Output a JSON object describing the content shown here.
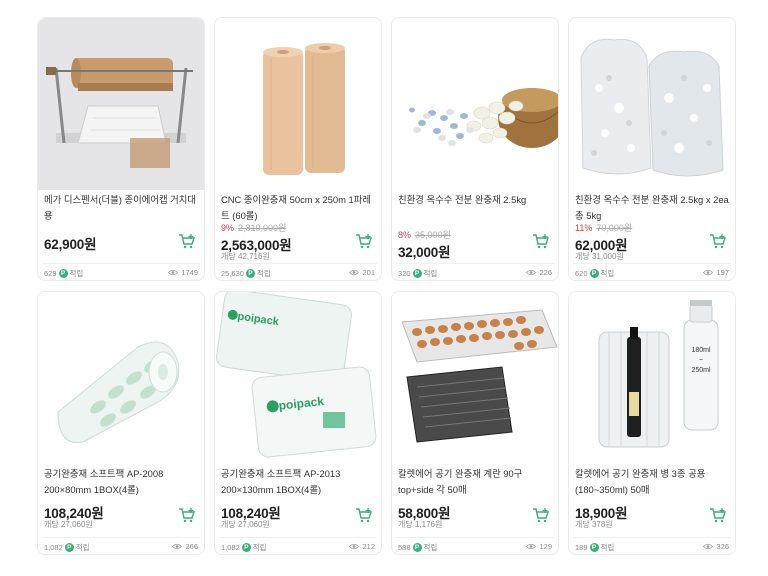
{
  "products": [
    {
      "title": "메가 디스펜서(더블) 종이에어캡 거치대용",
      "discount_rate": "",
      "original_price": "",
      "price": "62,900원",
      "unit_price": "",
      "points": "629",
      "points_label": "적립",
      "views": "1749",
      "image_icon": "paper-dispenser-image"
    },
    {
      "title": "CNC 종이완충재 50cm x 250m 1파레트 (60롤)",
      "discount_rate": "9%",
      "original_price": "2,810,000원",
      "price": "2,563,000원",
      "unit_price": "개당 42,716원",
      "points": "25,630",
      "points_label": "적립",
      "views": "201",
      "image_icon": "kraft-paper-rolls-image"
    },
    {
      "title": "친환경 옥수수 전분 완충재 2.5kg",
      "discount_rate": "8%",
      "original_price": "35,000원",
      "price": "32,000원",
      "unit_price": "",
      "points": "320",
      "points_label": "적립",
      "views": "226",
      "image_icon": "corn-starch-peanuts-image"
    },
    {
      "title": "친환경 옥수수 전분 완충재 2.5kg x 2ea 총 5kg",
      "discount_rate": "11%",
      "original_price": "70,000원",
      "price": "62,000원",
      "unit_price": "개당 31,000원",
      "points": "620",
      "points_label": "적립",
      "views": "197",
      "image_icon": "filler-bags-image"
    },
    {
      "title": "공기완충재 소프트팩 AP-2008 200×80mm 1BOX(4롤)",
      "discount_rate": "",
      "original_price": "",
      "price": "108,240원",
      "unit_price": "개당 27,060원",
      "points": "1,082",
      "points_label": "적립",
      "views": "266",
      "image_icon": "air-cushion-roll-image"
    },
    {
      "title": "공기완충재 소프트팩 AP-2013 200×130mm 1BOX(4롤)",
      "discount_rate": "",
      "original_price": "",
      "price": "108,240원",
      "unit_price": "개당 27,060원",
      "points": "1,082",
      "points_label": "적립",
      "views": "212",
      "image_icon": "poipack-air-bags-image"
    },
    {
      "title": "칼렛에어 공기 완충재 계란 90구 top+side 각 50매",
      "discount_rate": "",
      "original_price": "",
      "price": "58,800원",
      "unit_price": "개당 1,176원",
      "points": "588",
      "points_label": "적립",
      "views": "129",
      "image_icon": "egg-tray-image"
    },
    {
      "title": "칼렛에어 공기 완충재 병 3종 공용 (180~350ml) 50매",
      "discount_rate": "",
      "original_price": "",
      "price": "18,900원",
      "unit_price": "개당 378원",
      "points": "189",
      "points_label": "적립",
      "views": "326",
      "image_icon": "bottle-air-column-image"
    }
  ],
  "bottle_label": {
    "top": "180ml",
    "tilde": "~",
    "bottom": "250ml"
  },
  "brand_text": "poipack",
  "point_badge": "P",
  "colors": {
    "accent": "#3aaf7a",
    "discount": "#e03a3a",
    "price": "#222222"
  }
}
